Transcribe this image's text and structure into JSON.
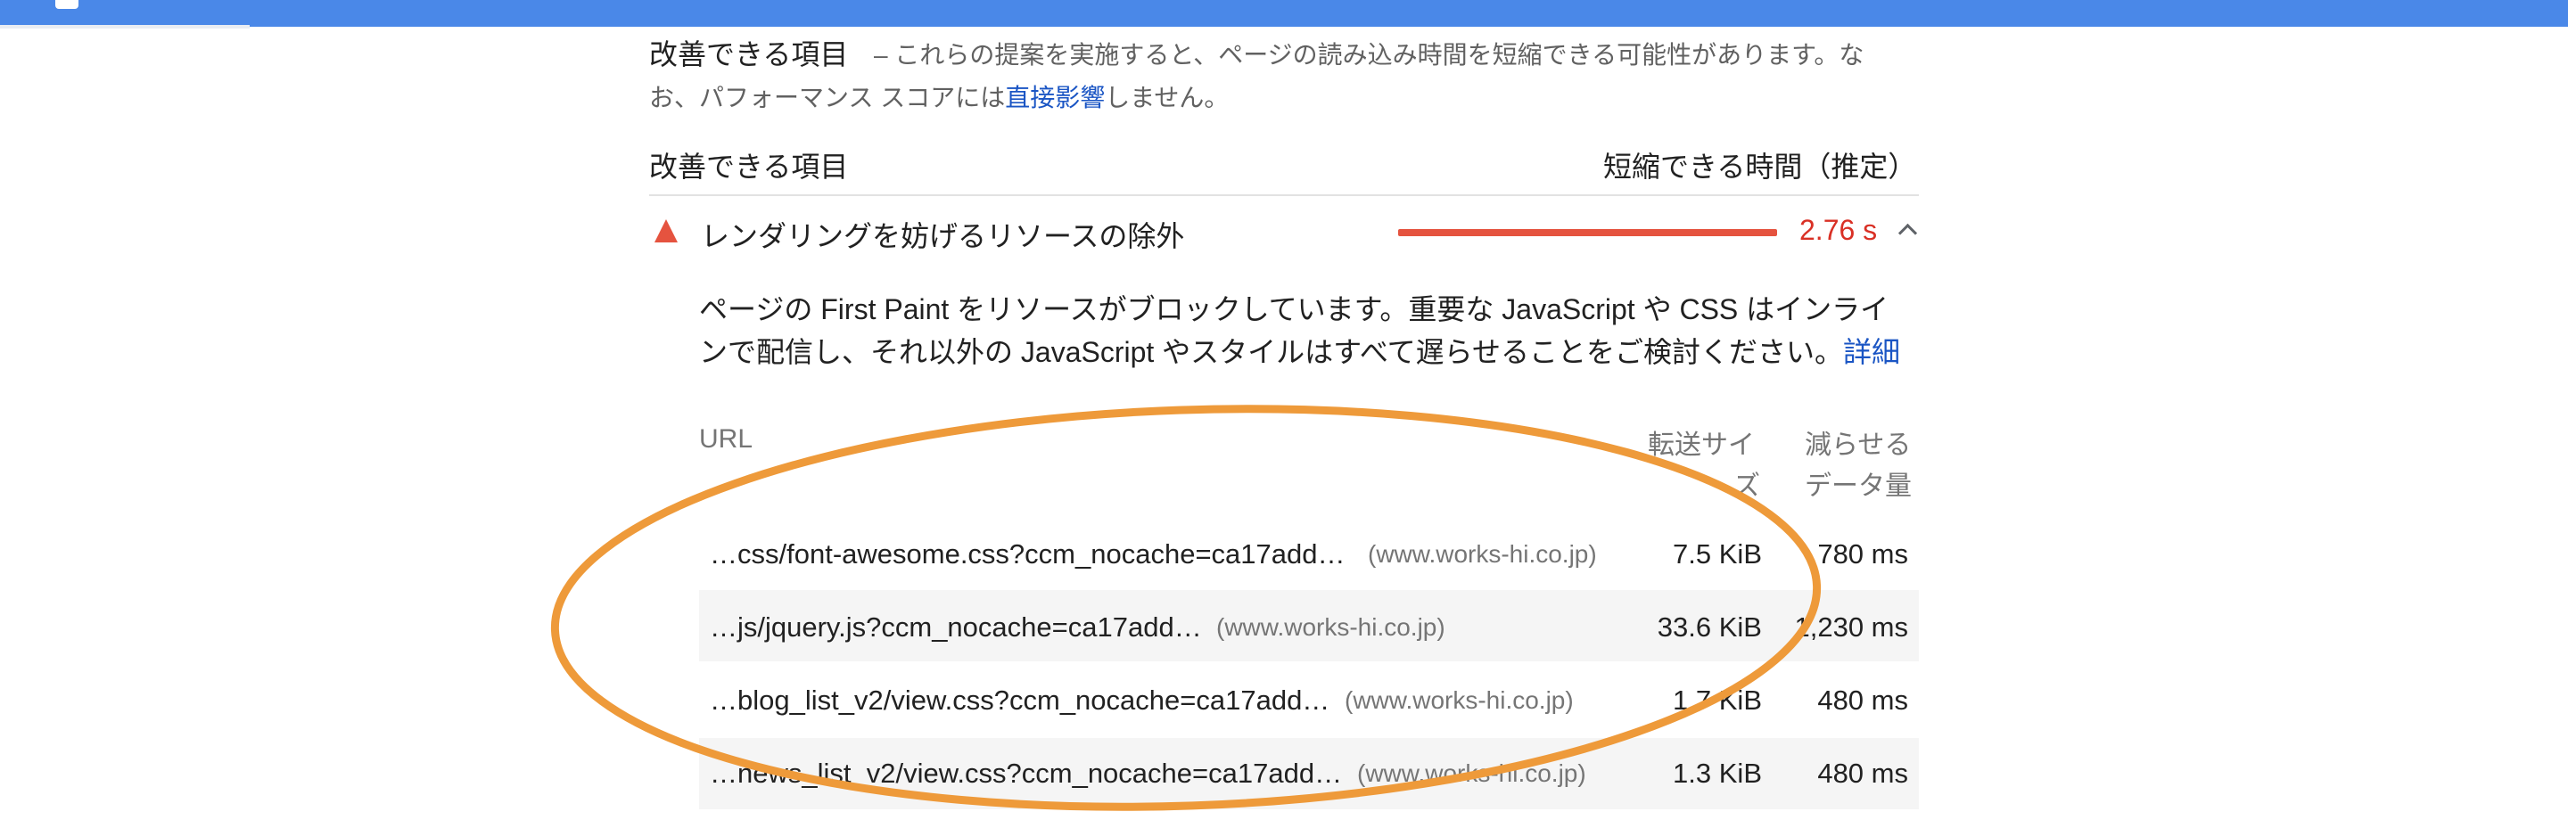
{
  "section": {
    "title": "改善できる項目",
    "desc_prefix": "– これらの提案を実施すると、ページの読み込み時間を短縮できる可能性があります。な",
    "desc_line2_prefix": "お、パフォーマンス スコアには",
    "desc_link": "直接影響",
    "desc_line2_suffix": "しません。"
  },
  "columns": {
    "left": "改善できる項目",
    "right": "短縮できる時間（推定）"
  },
  "audit": {
    "icon": "warning-triangle-icon",
    "title": "レンダリングを妨げるリソースの除外",
    "savings_fraction": 0.85,
    "value": "2.76 s",
    "status_color": "#e5533f",
    "description_line1": "ページの First Paint をリソースがブロックしています。重要な JavaScript や CSS はインライ",
    "description_line2": "ンで配信し、それ以外の JavaScript やスタイルはすべて遅らせることをご検討ください。",
    "learn_more": "詳細"
  },
  "table": {
    "headers": {
      "url": "URL",
      "transfer_line1": "転送サイ",
      "transfer_line2": "ズ",
      "savings_line1": "減らせる",
      "savings_line2": "データ量"
    },
    "rows": [
      {
        "url": "…css/font-awesome.css?ccm_nocache=ca17add…",
        "host": "(www.works-hi.co.jp)",
        "size": "7.5 KiB",
        "savings": "780 ms"
      },
      {
        "url": "…js/jquery.js?ccm_nocache=ca17add…",
        "host": "(www.works-hi.co.jp)",
        "size": "33.6 KiB",
        "savings": "1,230 ms"
      },
      {
        "url": "…blog_list_v2/view.css?ccm_nocache=ca17add…",
        "host": "(www.works-hi.co.jp)",
        "size": "1.7 KiB",
        "savings": "480 ms"
      },
      {
        "url": "…news_list_v2/view.css?ccm_nocache=ca17add…",
        "host": "(www.works-hi.co.jp)",
        "size": "1.3 KiB",
        "savings": "480 ms"
      }
    ]
  },
  "annotation_color": "#ee9a3a"
}
